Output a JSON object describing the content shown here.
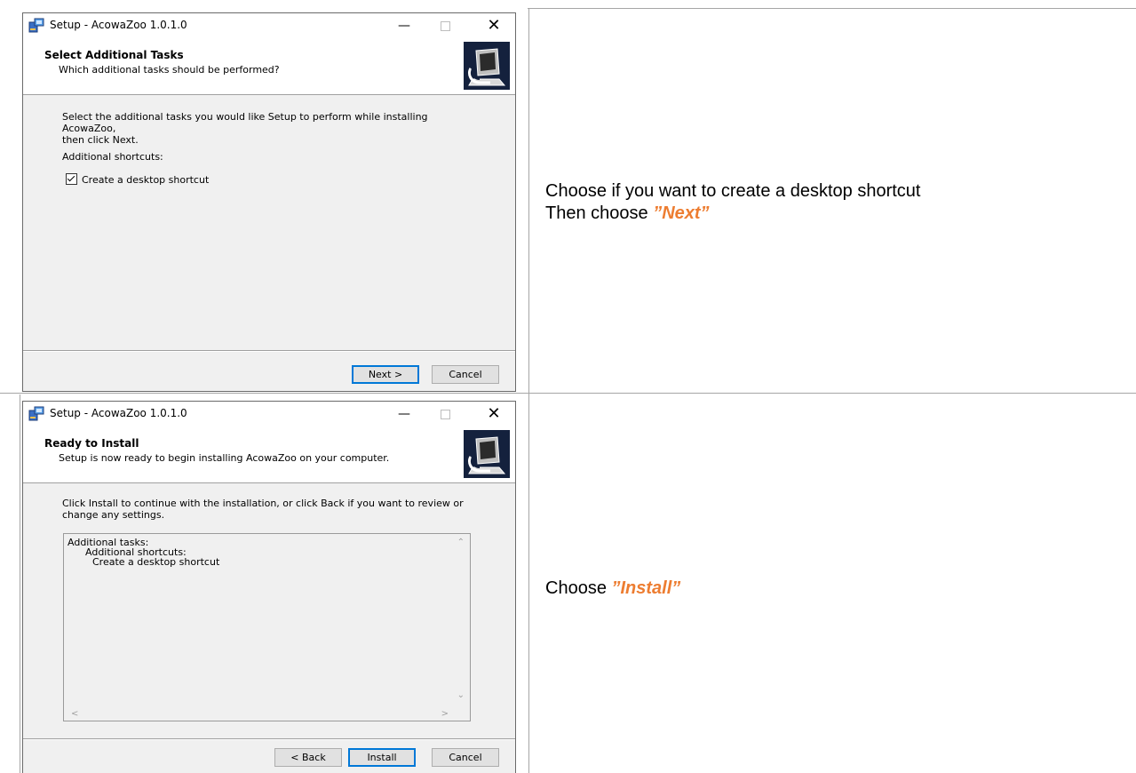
{
  "dialog1": {
    "title": "Setup - AcowaZoo 1.0.1.0",
    "header_title": "Select Additional Tasks",
    "header_subtitle": "Which additional tasks should be performed?",
    "body_line1": "Select the additional tasks you would like Setup to perform while installing AcowaZoo,",
    "body_line2": "then click Next.",
    "group_label": "Additional shortcuts:",
    "checkbox_label": "Create a desktop shortcut",
    "checkbox_checked": true,
    "next_label": "Next >",
    "cancel_label": "Cancel"
  },
  "dialog2": {
    "title": "Setup - AcowaZoo 1.0.1.0",
    "header_title": "Ready to Install",
    "header_subtitle": "Setup is now ready to begin installing AcowaZoo on your computer.",
    "body_line1": "Click Install to continue with the installation, or click Back if you want to review or",
    "body_line2": "change any settings.",
    "memo_line1": "Additional tasks:",
    "memo_line2": "Additional shortcuts:",
    "memo_line3": "Create a desktop shortcut",
    "back_label": "< Back",
    "install_label": "Install",
    "cancel_label": "Cancel"
  },
  "instructions": {
    "row1_line1": "Choose if you want to create a desktop shortcut",
    "row1_line2_prefix": "Then choose ",
    "row1_line2_emph": "”Next”",
    "row2_prefix": "Choose ",
    "row2_emph": "”Install”"
  },
  "colors": {
    "emphasis": "#ed7d31",
    "default_button_border": "#0078d7"
  }
}
